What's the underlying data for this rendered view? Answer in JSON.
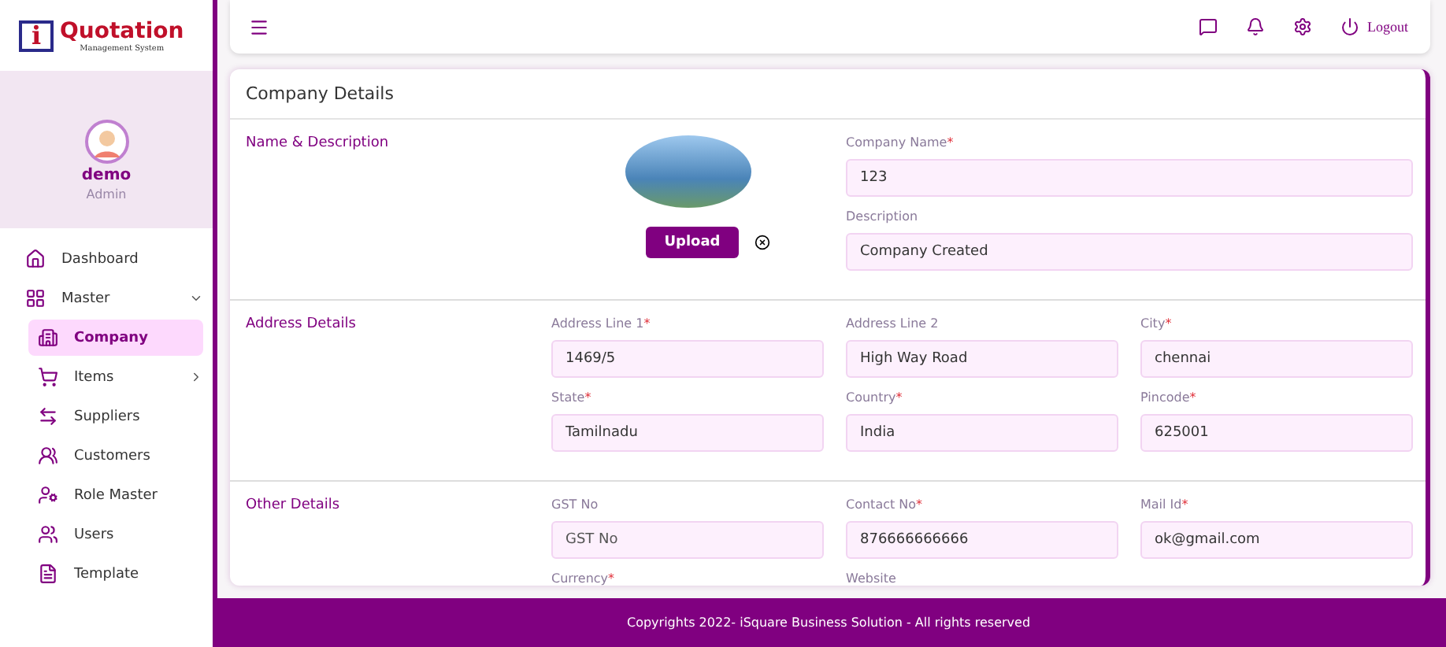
{
  "brand": {
    "letter": "i",
    "name": "Quotation",
    "tagline": "Management System"
  },
  "profile": {
    "name": "demo",
    "role": "Admin"
  },
  "sidebar": {
    "items": [
      {
        "label": "Dashboard",
        "selected": false
      },
      {
        "label": "Master",
        "selected": false,
        "expanded": true,
        "children": [
          {
            "label": "Company",
            "selected": true
          },
          {
            "label": "Items",
            "selected": false,
            "expanded": false
          },
          {
            "label": "Suppliers",
            "selected": false
          },
          {
            "label": "Customers",
            "selected": false
          },
          {
            "label": "Role Master",
            "selected": false
          },
          {
            "label": "Users",
            "selected": false
          },
          {
            "label": "Template",
            "selected": false
          }
        ]
      }
    ]
  },
  "topbar": {
    "logout": "Logout"
  },
  "card": {
    "title": "Company Details",
    "required_mark": "*",
    "sections": [
      {
        "kind": "upload",
        "title": "Name & Description",
        "upload_label": "Upload",
        "fields": [
          {
            "label": "Company Name",
            "required": true,
            "value": "123"
          },
          {
            "label": "Description",
            "required": false,
            "value": "Company Created"
          }
        ]
      },
      {
        "kind": "grid",
        "title": "Address Details",
        "fields": [
          {
            "label": "Address Line 1",
            "required": true,
            "value": "1469/5"
          },
          {
            "label": "Address Line 2",
            "required": false,
            "value": "High Way Road"
          },
          {
            "label": "City",
            "required": true,
            "value": "chennai"
          },
          {
            "label": "State",
            "required": true,
            "value": "Tamilnadu"
          },
          {
            "label": "Country",
            "required": true,
            "value": "India"
          },
          {
            "label": "Pincode",
            "required": true,
            "value": "625001"
          }
        ]
      },
      {
        "kind": "grid",
        "title": "Other Details",
        "fields": [
          {
            "label": "GST No",
            "required": false,
            "placeholder": "GST No"
          },
          {
            "label": "Contact No",
            "required": true,
            "value": "876666666666"
          },
          {
            "label": "Mail Id",
            "required": true,
            "value": "ok@gmail.com"
          },
          {
            "label": "Currency",
            "required": true
          },
          {
            "label": "Website",
            "required": false
          }
        ]
      }
    ]
  },
  "footer": "Copyrights 2022- iSquare Business Solution - All rights reserved"
}
